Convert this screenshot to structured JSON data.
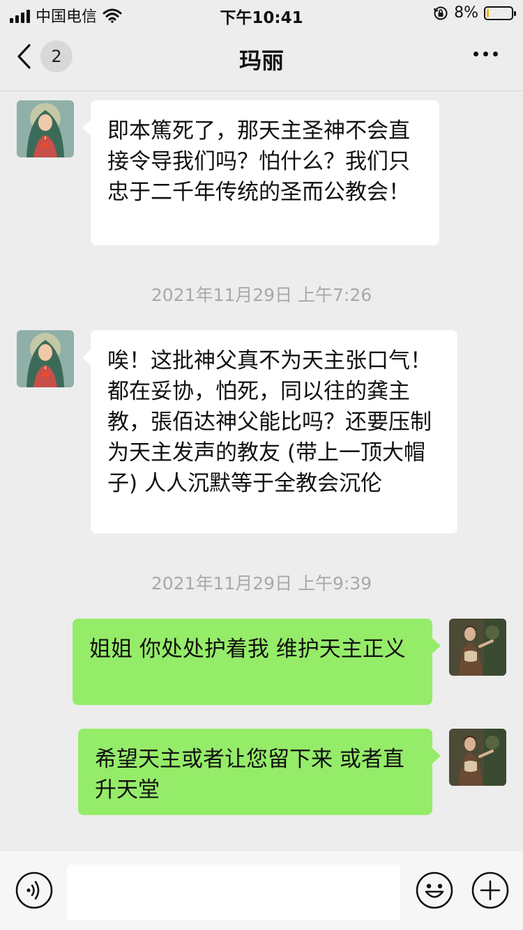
{
  "status_bar": {
    "carrier": "中国电信",
    "time": "下午10:41",
    "battery_percent": "8%",
    "battery_level": 0.08,
    "battery_color": "#f0b400"
  },
  "nav": {
    "back_icon": "chevron-left-icon",
    "unread_count": "2",
    "title": "玛丽",
    "more_icon": "more-icon"
  },
  "messages": [
    {
      "direction": "incoming",
      "avatar": "virgin-mary-avatar",
      "text": "即本篤死了，那天主圣神不会直接令导我们吗？怕什么？我们只忠于二千年传统的圣而公教会！"
    },
    {
      "type": "timestamp",
      "text": "2021年11月29日 上午7:26"
    },
    {
      "direction": "incoming",
      "avatar": "virgin-mary-avatar",
      "text": "唉！这批神父真不为天主张口气！都在妥协，怕死，同以往的龚主教，張佰达神父能比吗？还要压制为天主发声的教友 (带上一顶大帽子) 人人沉默等于全教会沉伦"
    },
    {
      "type": "timestamp",
      "text": "2021年11月29日 上午9:39"
    },
    {
      "direction": "outgoing",
      "avatar": "painting-woman-avatar",
      "text": "姐姐 你处处护着我 维护天主正义"
    },
    {
      "direction": "outgoing",
      "avatar": "painting-woman-avatar",
      "text": "希望天主或者让您留下来 或者直升天堂"
    }
  ],
  "input_bar": {
    "voice_icon": "voice-icon",
    "placeholder": "",
    "emoji_icon": "emoji-icon",
    "plus_icon": "plus-icon"
  },
  "colors": {
    "background": "#ededed",
    "incoming_bubble": "#ffffff",
    "outgoing_bubble": "#95ec69",
    "timestamp_text": "#a8a8a8"
  }
}
